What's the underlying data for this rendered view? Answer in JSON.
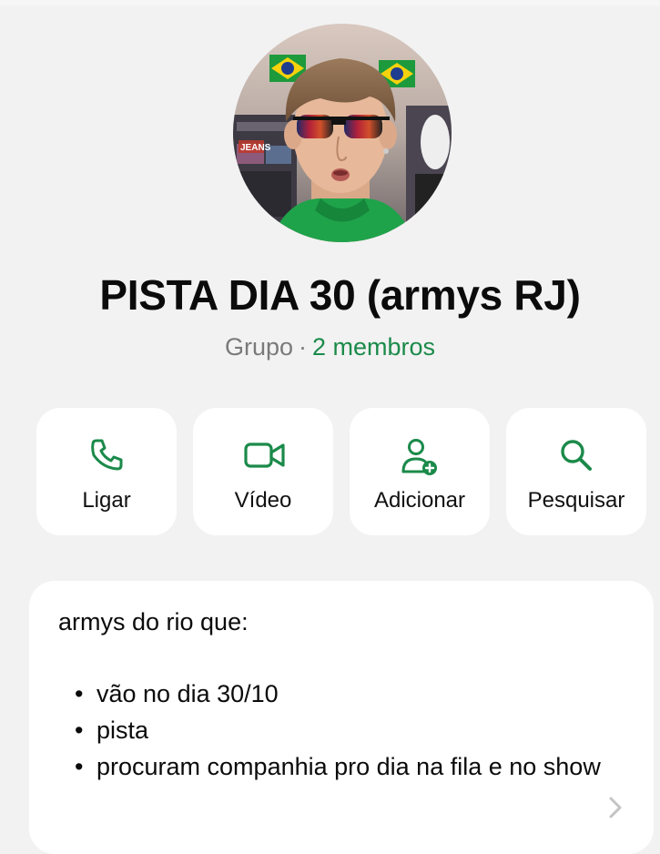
{
  "group": {
    "title": "PISTA DIA 30 (armys RJ)",
    "type_label": "Grupo",
    "separator": "·",
    "members": "2 membros"
  },
  "avatar": {
    "description": "group-photo",
    "sign_text": "JEANS"
  },
  "actions": [
    {
      "label": "Ligar",
      "icon": "phone-icon"
    },
    {
      "label": "Vídeo",
      "icon": "video-camera-icon"
    },
    {
      "label": "Adicionar",
      "icon": "add-person-icon"
    },
    {
      "label": "Pesquisar",
      "icon": "search-icon"
    }
  ],
  "description": {
    "heading": "armys do rio que:",
    "items": [
      "vão no dia 30/10",
      "pista",
      "procuram companhia pro dia na fila e no show"
    ]
  },
  "colors": {
    "accent": "#1b8a4a",
    "background": "#f2f2f2",
    "card": "#ffffff",
    "muted_text": "#7a7a7a"
  }
}
